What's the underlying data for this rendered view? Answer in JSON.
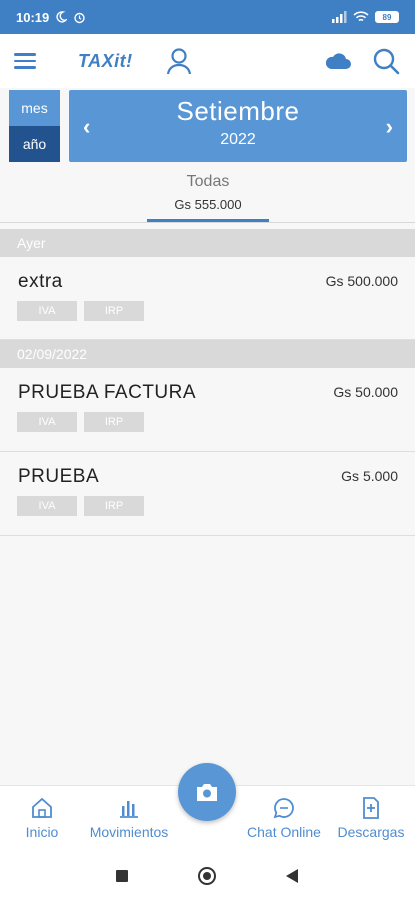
{
  "status": {
    "time": "10:19",
    "battery": "89"
  },
  "appbar": {
    "logo": "TAXit!",
    "icons": [
      "menu-icon",
      "user-icon",
      "cloud-icon",
      "search-icon"
    ]
  },
  "period": {
    "mode_month": "mes",
    "mode_year": "año",
    "month": "Setiembre",
    "year": "2022"
  },
  "tab": {
    "label": "Todas",
    "total": "Gs 555.000"
  },
  "sections": [
    {
      "header": "Ayer",
      "entries": [
        {
          "name": "extra",
          "amount": "Gs 500.000",
          "tags": [
            "IVA",
            "IRP"
          ]
        }
      ]
    },
    {
      "header": "02/09/2022",
      "entries": [
        {
          "name": "PRUEBA FACTURA",
          "amount": "Gs 50.000",
          "tags": [
            "IVA",
            "IRP"
          ]
        },
        {
          "name": "PRUEBA",
          "amount": "Gs 5.000",
          "tags": [
            "IVA",
            "IRP"
          ]
        }
      ]
    }
  ],
  "nav": {
    "inicio": "Inicio",
    "movimientos": "Movimientos",
    "chat": "Chat Online",
    "descargas": "Descargas"
  },
  "colors": {
    "primary": "#3f7fc4",
    "card": "#5896d6",
    "dark": "#23538e",
    "tag": "#d9d9d9"
  }
}
